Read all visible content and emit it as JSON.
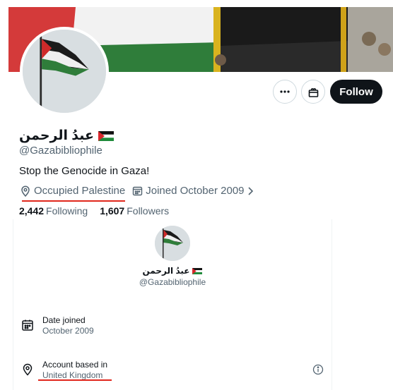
{
  "profile": {
    "display_name": "عبدُ الرحمن",
    "handle": "@Gazabibliophile",
    "bio": "Stop the Genocide in Gaza!",
    "location": "Occupied Palestine",
    "joined": "Joined October 2009",
    "following_count": "2,442",
    "following_label": "Following",
    "followers_count": "1,607",
    "followers_label": "Followers"
  },
  "actions": {
    "follow_label": "Follow"
  },
  "about": {
    "display_name": "عبدُ الرحمن",
    "handle": "@Gazabibliophile",
    "date_joined_label": "Date joined",
    "date_joined_value": "October 2009",
    "account_based_label": "Account based in",
    "account_based_value": "United Kingdom"
  },
  "colors": {
    "follow_bg": "#0f1419",
    "secondary_text": "#536471",
    "annotation_underline": "#e0271c"
  },
  "icons": [
    "more-icon",
    "gift-icon",
    "location-pin-icon",
    "calendar-icon",
    "chevron-right-icon",
    "info-icon",
    "palestine-flag-icon"
  ]
}
